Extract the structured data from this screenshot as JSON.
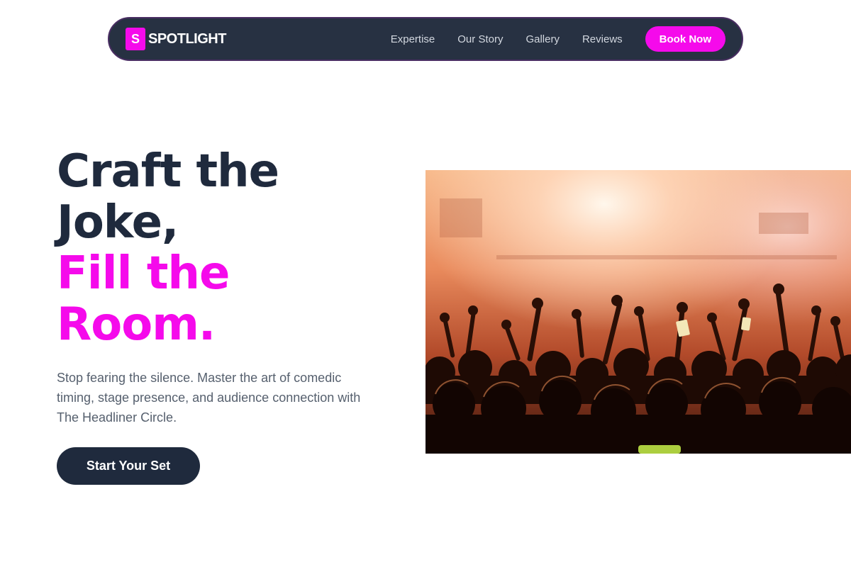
{
  "brand": {
    "mark": "S",
    "name": "SPOTLIGHT"
  },
  "nav": {
    "links": [
      "Expertise",
      "Our Story",
      "Gallery",
      "Reviews"
    ],
    "cta_label": "Book Now"
  },
  "hero": {
    "headline_line1": "Craft the",
    "headline_line2": "Joke,",
    "headline_accent_line1": "Fill the",
    "headline_accent_line2": "Room.",
    "lede": "Stop fearing the silence. Master the art of comedic timing, stage presence, and audience connection with The Headliner Circle.",
    "cta_label": "Start Your Set",
    "image_alt": "concert-crowd-photo"
  },
  "colors": {
    "accent": "#f50aeb",
    "navy": "#1f2a3d",
    "nav_bg": "#273142",
    "body_text": "#56606e"
  }
}
